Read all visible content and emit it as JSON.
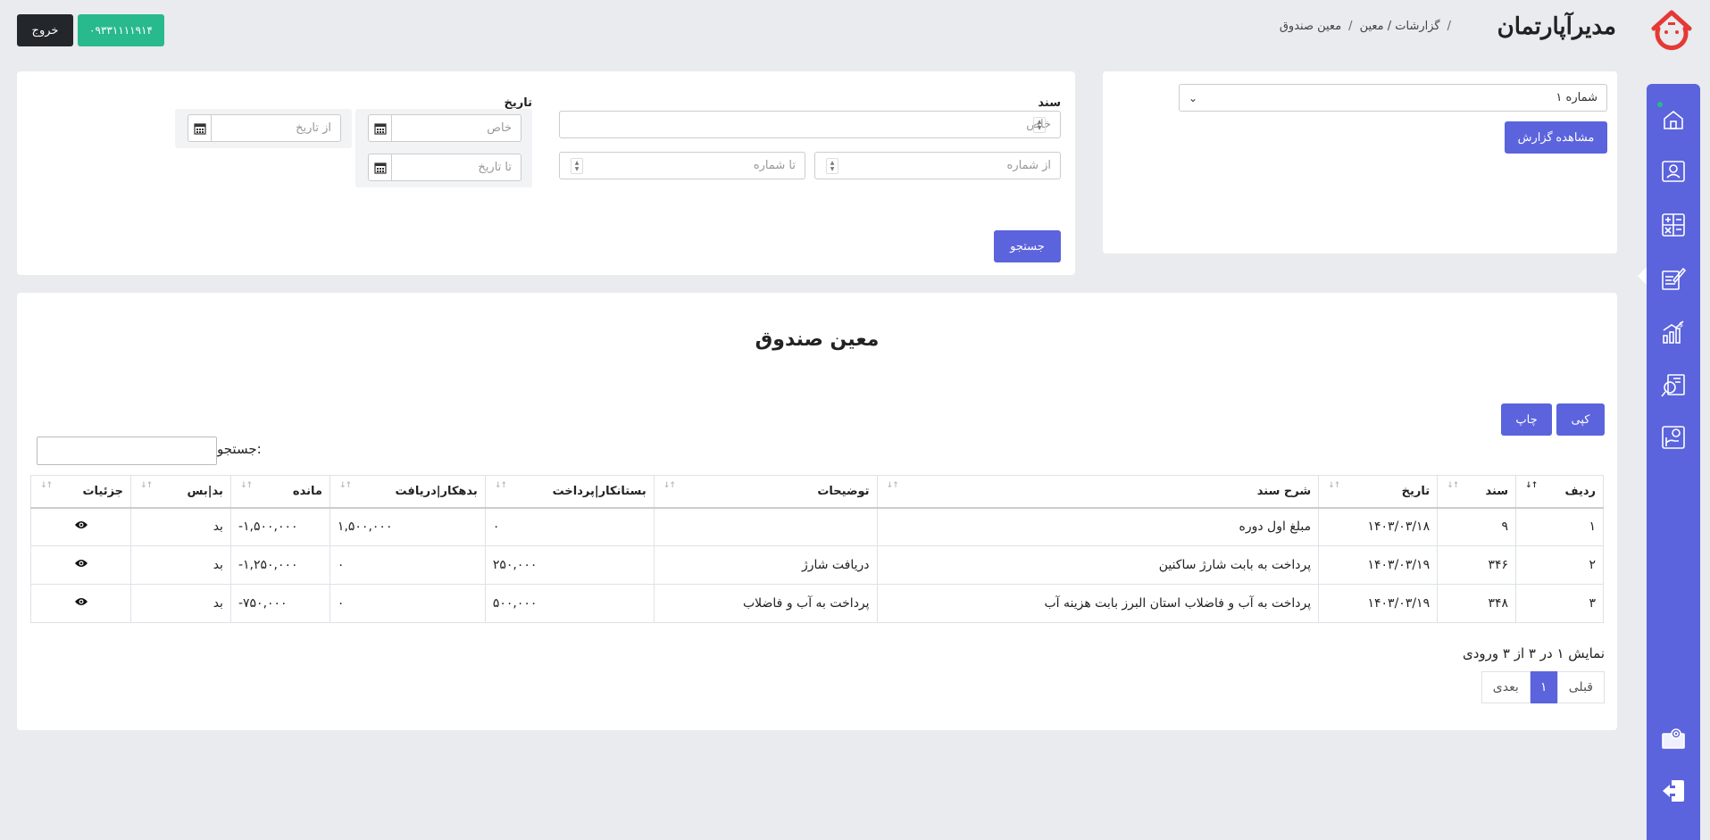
{
  "header": {
    "brand": "مدیرآپارتمان",
    "breadcrumb": [
      "گزارشات / معین",
      "معین صندوق"
    ],
    "phone": "۰۹۳۳۱۱۱۱۹۱۴",
    "logout": "خروج"
  },
  "report_card": {
    "selected_fund": "شماره ۱",
    "view_button": "مشاهده گزارش"
  },
  "filter": {
    "doc_label": "سند",
    "doc_specific_placeholder": "خاص",
    "doc_from_placeholder": "از شماره",
    "doc_to_placeholder": "تا شماره",
    "date_label": "تاریخ",
    "date_specific_placeholder": "خاص",
    "date_to_placeholder": "تا تاریخ",
    "date_from_placeholder": "از تاریخ",
    "search_button": "جستجو"
  },
  "table_section": {
    "title": "معین صندوق",
    "copy_button": "کپی",
    "print_button": "چاپ",
    "search_label": "جستجو:",
    "columns": [
      "ردیف",
      "سند",
      "تاریخ",
      "شرح سند",
      "توضیحات",
      "بستانکار|پرداخت",
      "بدهکار|دریافت",
      "مانده",
      "بد|بس",
      "جزئیات"
    ],
    "rows": [
      {
        "row": "۱",
        "doc": "۹",
        "date": "۱۴۰۳/۰۳/۱۸",
        "desc": "مبلغ اول دوره",
        "notes": "",
        "credit": "۰",
        "debit": "۱,۵۰۰,۰۰۰",
        "balance": "-۱,۵۰۰,۰۰۰",
        "type": "بد"
      },
      {
        "row": "۲",
        "doc": "۳۴۶",
        "date": "۱۴۰۳/۰۳/۱۹",
        "desc": "پرداخت به بابت شارژ ساکنین",
        "notes": "دریافت شارژ",
        "credit": "۲۵۰,۰۰۰",
        "debit": "۰",
        "balance": "-۱,۲۵۰,۰۰۰",
        "type": "بد"
      },
      {
        "row": "۳",
        "doc": "۳۴۸",
        "date": "۱۴۰۳/۰۳/۱۹",
        "desc": "پرداخت به آب و فاضلاب استان البرز بابت هزینه آب",
        "notes": "پرداخت به آب و فاضلاب",
        "credit": "۵۰۰,۰۰۰",
        "debit": "۰",
        "balance": "-۷۵۰,۰۰۰",
        "type": "بد"
      }
    ],
    "info": "نمایش ۱ در ۳ از ۳ ورودی",
    "pager": {
      "prev": "قبلی",
      "page": "۱",
      "next": "بعدی"
    }
  },
  "sidebar": {
    "items": [
      "home-icon",
      "user-card-icon",
      "calculator-icon",
      "document-edit-icon",
      "chart-growth-icon",
      "report-search-icon",
      "hand-money-icon",
      "settings-envelope-icon",
      "exit-icon"
    ]
  },
  "colors": {
    "primary": "#5b63dd",
    "success": "#28b98d",
    "dark": "#23272b",
    "brand_red": "#e53935"
  }
}
